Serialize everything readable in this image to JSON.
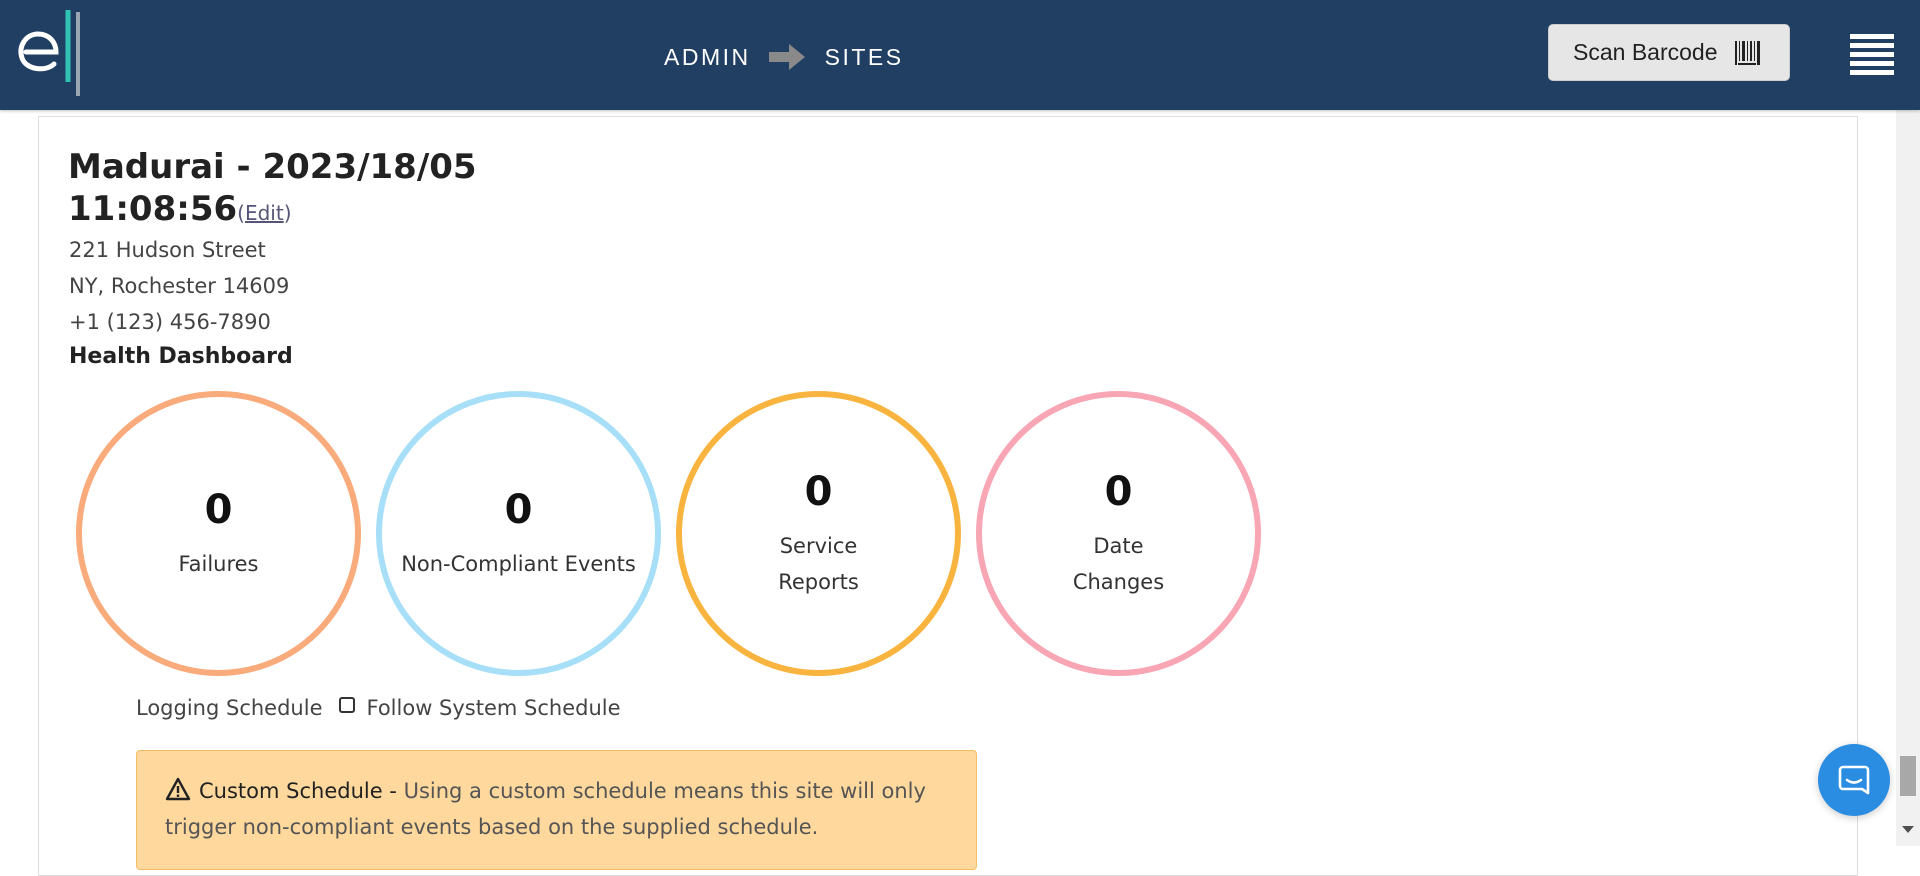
{
  "header": {
    "breadcrumb": [
      "ADMIN",
      "SITES"
    ],
    "scan_button_label": "Scan Barcode",
    "background_color": "#213f63"
  },
  "site": {
    "title_line1": "Madurai - 2023/18/05",
    "title_line2": "11:08:56",
    "edit_open": "(",
    "edit_label": "Edit",
    "edit_close": ")",
    "address_line1": "221 Hudson Street",
    "address_line2": "NY, Rochester 14609",
    "phone": "+1 (123) 456-7890"
  },
  "health": {
    "title": "Health Dashboard",
    "stats": [
      {
        "value": "0",
        "label": "Failures",
        "color": "#f9ab7c"
      },
      {
        "value": "0",
        "label": "Non-Compliant Events",
        "color": "#a7def8"
      },
      {
        "value": "0",
        "label": "Service\nReports",
        "color": "#f8b43f"
      },
      {
        "value": "0",
        "label": "Date\nChanges",
        "color": "#f8a5b4"
      }
    ]
  },
  "logging": {
    "label": "Logging Schedule",
    "checkbox_label": "Follow System Schedule",
    "checked": false
  },
  "alert": {
    "title": "Custom Schedule -",
    "text": "Using a custom schedule means this site will only trigger non-compliant events based on the supplied schedule.",
    "background_color": "#fed89c"
  },
  "icons": {
    "logo": "logo-icon",
    "breadcrumb_separator": "arrow-right-icon",
    "scan": "barcode-icon",
    "menu": "hamburger-menu-icon",
    "alert": "warning-icon",
    "chat": "chat-icon"
  }
}
